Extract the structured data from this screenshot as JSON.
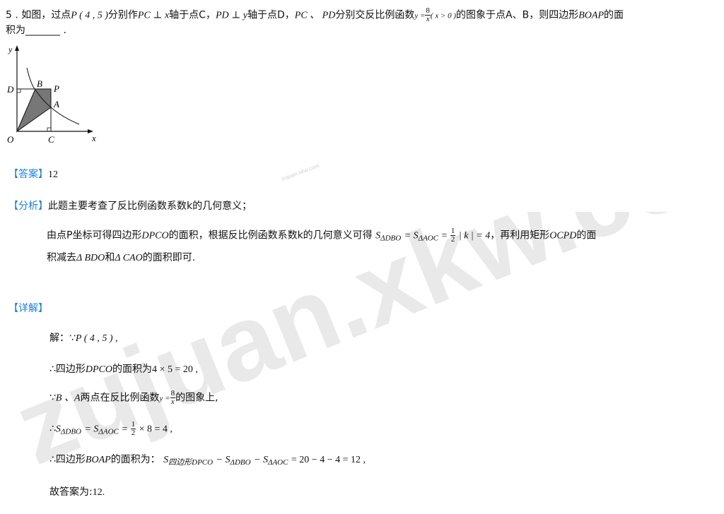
{
  "question": {
    "line1_a": "5 . 如图，过点",
    "P45": "P ( 4 , 5 )",
    "line1_b": "分别作",
    "PC_perp_x": "PC ⊥ x",
    "line1_c": "轴于点C，",
    "PD_perp_y": "PD ⊥ y",
    "line1_d": "轴于点D，",
    "PC_PD": "PC 、 PD",
    "line1_e": "分别交反比例函数",
    "func_y": "y =",
    "func_num": "8",
    "func_den": "x",
    "func_cond": "( x > 0 )",
    "line1_f": "的图象于点A、B，则四边形",
    "BOAP": "BOAP",
    "line1_g": "的面",
    "line2": "积为_______ ."
  },
  "figure": {
    "label_y": "y",
    "label_x": "x",
    "label_O": "O",
    "label_C": "C",
    "label_D": "D",
    "label_B": "B",
    "label_P": "P",
    "label_A": "A"
  },
  "answer": {
    "tag": "【答案】",
    "value": "12"
  },
  "analysis": {
    "tag": "【分析】",
    "summary": "此题主要考查了反比例函数系数k的几何意义；",
    "detail1_a": "由点P坐标可得四边形",
    "DPCO": "DPCO",
    "detail1_b": "的面积，根据反比例函数系数k的几何意义可得",
    "formula_s1": "S",
    "formula_s1_sub": "ΔDBO",
    "formula_eq1": "= S",
    "formula_s2_sub": "ΔAOC",
    "formula_eq2": "=",
    "half_num": "1",
    "half_den": "2",
    "formula_k": "| k | = 4",
    "detail1_c": "，再利用矩形",
    "OCPD": "OCPD",
    "detail1_d": "的面",
    "detail2_a": "积减去",
    "tri_BDO": "Δ BDO",
    "detail2_b": "和",
    "tri_CAO": "Δ CAO",
    "detail2_c": "的面积即可."
  },
  "solution": {
    "tag": "【详解】",
    "s1_a": "解：∵",
    "s1_b": "P ( 4 , 5 ) ,",
    "s2_a": "∴四边形",
    "s2_b": "DPCO",
    "s2_c": "的面积为",
    "s2_d": "4 × 5 = 20 ,",
    "s3_a": "∵",
    "s3_b": "B 、A",
    "s3_c": "两点在反比例函数",
    "s3_d": "y =",
    "s3_num": "8",
    "s3_den": "x",
    "s3_e": "的图象上,",
    "s4_a": "∴",
    "s4_s": "S",
    "s4_sub1": "ΔDBO",
    "s4_eq": "= S",
    "s4_sub2": "ΔAOC",
    "s4_eq2": "=",
    "s4_num": "1",
    "s4_den": "2",
    "s4_tail": "× 8 = 4 ,",
    "s5_a": "∴四边形",
    "s5_b": "BOAP",
    "s5_c": "的面积为：",
    "s5_s": "S",
    "s5_sub": "四边形DPCO",
    "s5_mid": "− S",
    "s5_sub2": "ΔDBO",
    "s5_mid2": "− S",
    "s5_sub3": "ΔAOC",
    "s5_tail": "= 20 − 4 − 4 = 12 ,",
    "s6_a": "故答案为:",
    "s6_b": "12."
  },
  "watermark": {
    "text": "zujuan.xkw.com",
    "stamp": "zujuan.xkw.com"
  }
}
